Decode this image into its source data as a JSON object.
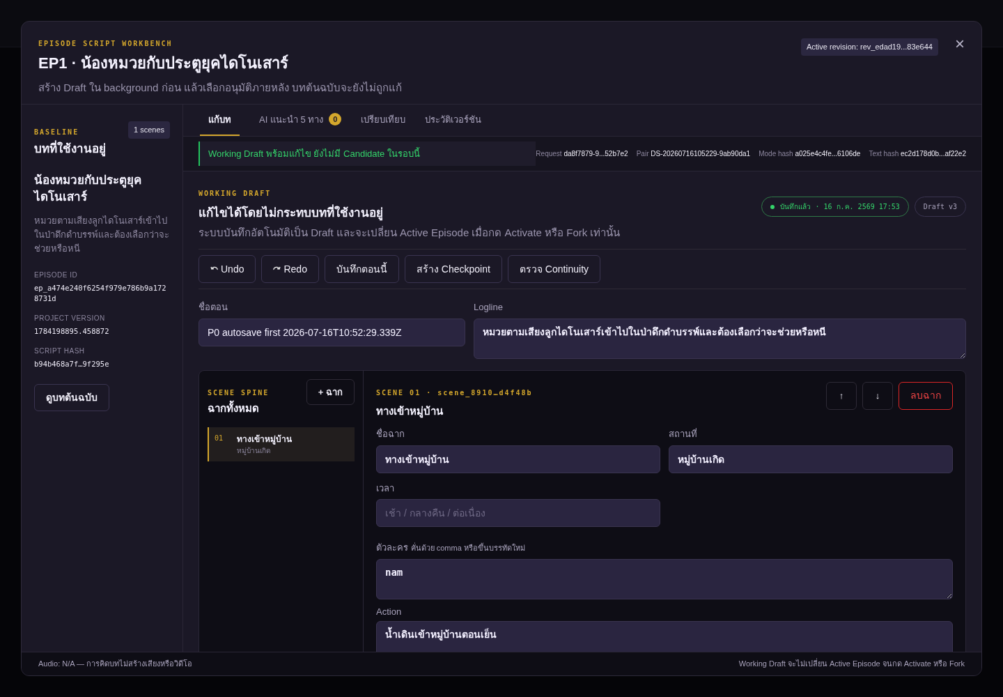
{
  "header": {
    "eyebrow": "EPISODE SCRIPT WORKBENCH",
    "title": "EP1 · น้องหมวยกับประตูยุคไดโนเสาร์",
    "subtitle": "สร้าง Draft ใน background ก่อน แล้วเลือกอนุมัติภายหลัง บทต้นฉบับจะยังไม่ถูกแก้",
    "revision": "Active revision: rev_edad19...83e644",
    "close": "×"
  },
  "sidebar": {
    "eyebrow": "BASELINE",
    "scenes_badge": "1 scenes",
    "title": "บทที่ใช้งานอยู่",
    "episode_title": "น้องหมวยกับประตูยุคไดโนเสาร์",
    "logline": "หมวยตามเสียงลูกไดโนเสาร์เข้าไปในป่าดึกดำบรรพ์และต้องเลือกว่าจะช่วยหรือหนี",
    "meta": [
      {
        "label": "EPISODE ID",
        "value": "ep_a474e240f6254f979e786b9a1728731d"
      },
      {
        "label": "PROJECT VERSION",
        "value": "1784198895.458872"
      },
      {
        "label": "SCRIPT HASH",
        "value": "b94b468a7f…9f295e"
      }
    ],
    "button": "ดูบทต้นฉบับ"
  },
  "tabs": [
    {
      "label": "แก้บท",
      "selected": true
    },
    {
      "label": "AI แนะนำ 5 ทาง",
      "badge": "0",
      "selected": false
    },
    {
      "label": "เปรียบเทียบ",
      "selected": false
    },
    {
      "label": "ประวัติเวอร์ชัน",
      "selected": false
    }
  ],
  "notice": "Working Draft พร้อมแก้ไข ยังไม่มี Candidate ในรอบนี้",
  "hashes": [
    {
      "label": "Request",
      "value": "da8f7879-9...52b7e2"
    },
    {
      "label": "Pair",
      "value": "DS-20260716105229-9ab90da1"
    },
    {
      "label": "Mode hash",
      "value": "a025e4c4fe...6106de"
    },
    {
      "label": "Text hash",
      "value": "ec2d178d0b...af22e2"
    }
  ],
  "draft": {
    "eyebrow": "WORKING DRAFT",
    "title": "แก้ไขได้โดยไม่กระทบบทที่ใช้งานอยู่",
    "description": "ระบบบันทึกอัตโนมัติเป็น Draft และจะเปลี่ยน Active Episode เมื่อกด Activate หรือ Fork เท่านั้น",
    "save_status": "บันทึกแล้ว · 16 ก.ค. 2569 17:53",
    "version": "Draft v3",
    "actions": [
      {
        "label": "Undo",
        "kind": "undo"
      },
      {
        "label": "Redo",
        "kind": "redo"
      },
      {
        "label": "บันทึกตอนนี้",
        "kind": "plain"
      },
      {
        "label": "สร้าง Checkpoint",
        "kind": "plain"
      },
      {
        "label": "ตรวจ Continuity",
        "kind": "plain"
      }
    ],
    "name_label": "ชื่อตอน",
    "name_value": "P0 autosave first 2026-07-16T10:52:29.339Z",
    "logline_label": "Logline",
    "logline_value": "หมวยตามเสียงลูกไดโนเสาร์เข้าไปในป่าดึกดำบรรพ์และต้องเลือกว่าจะช่วยหรือหนี"
  },
  "spine": {
    "eyebrow": "SCENE SPINE",
    "title": "ฉากทั้งหมด",
    "add": "+ ฉาก",
    "scenes": [
      {
        "number": "01",
        "title": "ทางเข้าหมู่บ้าน",
        "location": "หมู่บ้านเกิด",
        "selected": true
      }
    ]
  },
  "scene": {
    "eyebrow": "SCENE 01 · scene_8910…d4f48b",
    "title": "ทางเข้าหมู่บ้าน",
    "up": "↑",
    "down": "↓",
    "delete": "ลบฉาก",
    "name_label": "ชื่อฉาก",
    "name_value": "ทางเข้าหมู่บ้าน",
    "place_label": "สถานที่",
    "place_value": "หมู่บ้านเกิด",
    "time_label": "เวลา",
    "time_placeholder": "เช้า / กลางคืน / ต่อเนื่อง",
    "chars_label": "ตัวละคร",
    "chars_hint": "คั่นด้วย comma หรือขึ้นบรรทัดใหม่",
    "chars_value": "nam",
    "action_label": "Action",
    "action_value": "น้ำเดินเข้าหมู่บ้านตอนเย็น"
  },
  "footer": {
    "left": "Audio: N/A — การคิดบทไม่สร้างเสียงหรือวิดีโอ",
    "right": "Working Draft จะไม่เปลี่ยน Active Episode จนกด Activate หรือ Fork"
  }
}
